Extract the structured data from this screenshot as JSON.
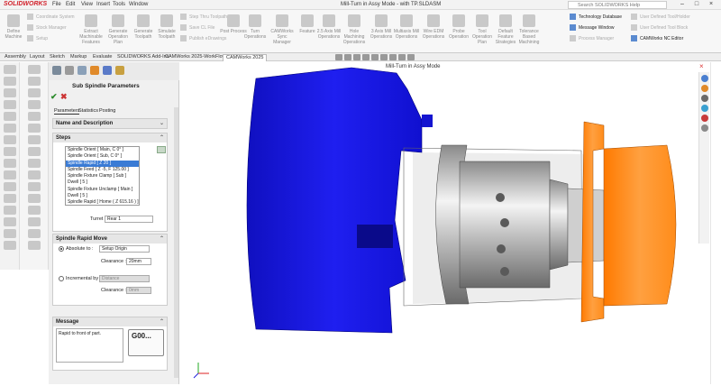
{
  "app": {
    "logo": "SOLIDWORKS",
    "title": "Mill-Turn in Assy Mode - with TP.SLDASM",
    "search_placeholder": "Search SOLIDWORKS Help"
  },
  "menu": [
    "File",
    "Edit",
    "View",
    "Insert",
    "Tools",
    "Window"
  ],
  "ribbon": {
    "buttons": [
      "Define Machine",
      "Coordinate System",
      "Stock Manager",
      "Setup",
      "Extract Machinable Features",
      "Generate Operation Plan",
      "Generate Toolpath",
      "Simulate Toolpath",
      "Step Thru Toolpath",
      "Save CL File",
      "Publish eDrawings",
      "Post Process",
      "Turn Operations",
      "CAMWorks Sync Manager",
      "Feature",
      "2.5 Axis Mill Operations",
      "Hole Machining Operations",
      "3 Axis Mill Operations",
      "Multiaxis Mill Operations",
      "Wire EDM Operations",
      "Probe Operation",
      "Tool Operation Plan",
      "Default Feature Strategies",
      "Tolerance Based Machining"
    ],
    "side_items": [
      {
        "label": "Technology Database",
        "enabled": true
      },
      {
        "label": "Message Window",
        "enabled": true
      },
      {
        "label": "Process Manager",
        "enabled": false
      },
      {
        "label": "User Defined Tool/Holder",
        "enabled": false
      },
      {
        "label": "User Defined Tool Block",
        "enabled": false
      },
      {
        "label": "CAMWorks NC Editor",
        "enabled": true
      }
    ]
  },
  "tabs": [
    "Assembly",
    "Layout",
    "Sketch",
    "Markup",
    "Evaluate",
    "SOLIDWORKS Add-Ins",
    "CAMWorks 2025-WorkFlow",
    "CAMWorks 2025"
  ],
  "active_tab": "CAMWorks 2025",
  "viewport_title": "Mill-Turn in Assy Mode",
  "pm": {
    "title": "Sub Spindle Parameters",
    "tabs": [
      "Parameters",
      "Statistics",
      "Posting"
    ],
    "name_desc": "Name and Description",
    "steps_header": "Steps",
    "steps": [
      "Spindle Orient [ Main, C 0° ]",
      "Spindle Orient [ Sub, C 0° ]",
      "Spindle Rapid [ Z 20 ]",
      "Spindle Feed [ Z -5, F 125.00 ]",
      "Spindle Fixture Clamp [ Sub ]",
      "Dwell [ 5 ]",
      "Spindle Fixture Unclamp [ Main ]",
      "Dwell [ 5 ]",
      "Spindle Rapid [ Home ( Z 615.16 ) ]"
    ],
    "selected_step": 2,
    "turret_label": "Turret :",
    "turret_value": "Rear 1",
    "move_header": "Spindle Rapid Move",
    "absolute_label": "Absolute to :",
    "absolute_value": "Setup Origin",
    "clearance_label": "Clearance :",
    "clearance_abs": "20mm",
    "incremental_label": "Incremental by :",
    "incremental_value": "Distance",
    "clearance_inc": "0mm",
    "message_header": "Message",
    "message": "Rapid to front of part.",
    "gcode": "G00..."
  },
  "colors": {
    "housing": "#1a1ae6",
    "sub_spindle": "#ff8c1a",
    "part": "#b9b9b9",
    "selection": "#3a7bd5"
  }
}
